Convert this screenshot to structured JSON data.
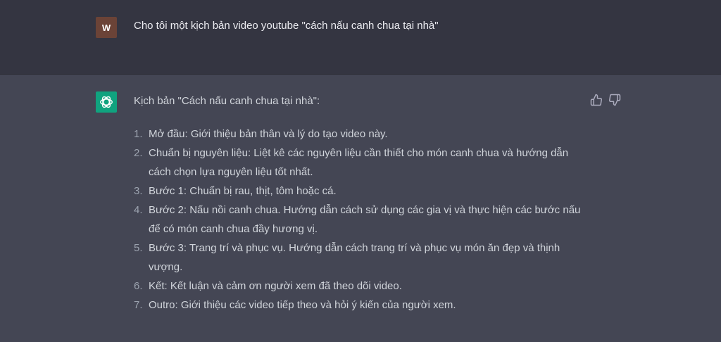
{
  "user": {
    "avatar_letter": "W",
    "message": "Cho tôi một kịch bản video youtube \"cách nấu canh chua tại nhà\""
  },
  "assistant": {
    "intro": "Kịch bản \"Cách nấu canh chua tại nhà\":",
    "steps": [
      {
        "num": "1.",
        "text": "Mở đầu: Giới thiệu bản thân và lý do tạo video này."
      },
      {
        "num": "2.",
        "text": "Chuẩn bị nguyên liệu: Liệt kê các nguyên liệu cần thiết cho món canh chua và hướng dẫn cách chọn lựa nguyên liệu tốt nhất."
      },
      {
        "num": "3.",
        "text": "Bước 1: Chuẩn bị rau, thịt, tôm hoặc cá."
      },
      {
        "num": "4.",
        "text": "Bước 2: Nấu nồi canh chua. Hướng dẫn cách sử dụng các gia vị và thực hiện các bước nấu để có món canh chua đầy hương vị."
      },
      {
        "num": "5.",
        "text": "Bước 3: Trang trí và phục vụ. Hướng dẫn cách trang trí và phục vụ món ăn đẹp và thịnh vượng."
      },
      {
        "num": "6.",
        "text": "Kết: Kết luận và cảm ơn người xem đã theo dõi video."
      },
      {
        "num": "7.",
        "text": "Outro: Giới thiệu các video tiếp theo và hỏi ý kiến của người xem."
      }
    ]
  },
  "icons": {
    "ai_avatar": "openai-logo-icon",
    "like": "thumbs-up-icon",
    "dislike": "thumbs-down-icon"
  },
  "colors": {
    "user_bg": "#343541",
    "assistant_bg": "#444654",
    "ai_avatar_bg": "#10a37f",
    "user_avatar_bg": "#6b4337"
  }
}
